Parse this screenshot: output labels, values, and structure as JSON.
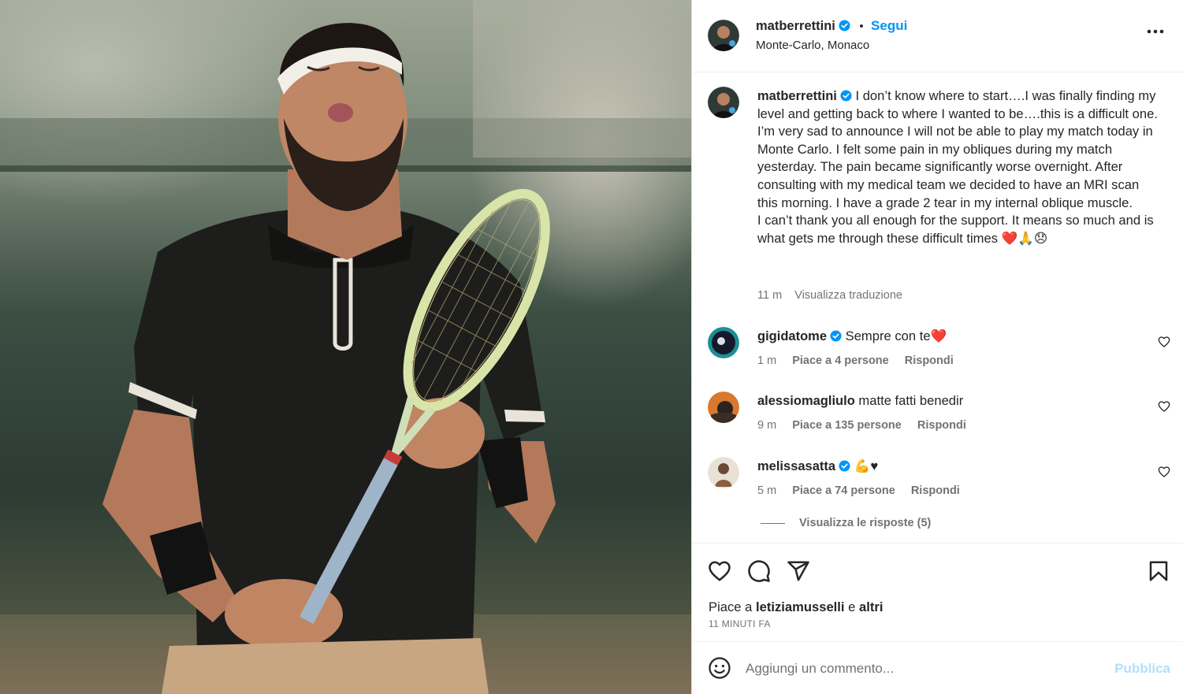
{
  "post": {
    "username": "matberrettini",
    "separator": "•",
    "follow_label": "Segui",
    "location": "Monte-Carlo, Monaco",
    "caption_lines": [
      "I don’t know where to start….I was finally finding my level and getting back to where I wanted to be….this is a difficult one.",
      "I’m very sad to announce I will not be able to play my match today in Monte Carlo. I felt some pain in my obliques during my match yesterday. The pain became significantly worse overnight. After consulting with my medical team we decided to have an MRI scan this morning. I have a grade 2 tear in my internal oblique muscle.",
      "I can’t thank you all enough for the support. It means so much and is what gets me through these difficult times ❤️🙏😞"
    ],
    "caption_time": "11 m",
    "translate_label": "Visualizza traduzione"
  },
  "comments": [
    {
      "username": "gigidatome",
      "verified": true,
      "text": "Sempre con te❤️",
      "time": "1 m",
      "likes": "Piace a 4 persone",
      "reply": "Rispondi"
    },
    {
      "username": "alessiomagliulo",
      "verified": false,
      "text": "matte fatti benedir",
      "time": "9 m",
      "likes": "Piace a 135 persone",
      "reply": "Rispondi"
    },
    {
      "username": "melissasatta",
      "verified": true,
      "text": "💪♥",
      "time": "5 m",
      "likes": "Piace a 74 persone",
      "reply": "Rispondi"
    }
  ],
  "view_replies": "Visualizza le risposte (5)",
  "actions": {
    "likes_prefix": "Piace a",
    "likes_user": "letiziamusselli",
    "likes_and": "e",
    "likes_others": "altri",
    "timestamp": "11 MINUTI FA"
  },
  "compose": {
    "placeholder": "Aggiungi un commento...",
    "publish_label": "Pubblica"
  },
  "colors": {
    "accent": "#0095f6",
    "publish_disabled": "#b2dffc",
    "secondary_text": "#737373"
  },
  "icons": [
    "verified-badge-icon",
    "more-options-icon",
    "heart-icon",
    "comment-icon",
    "share-icon",
    "bookmark-icon",
    "emoji-icon"
  ]
}
